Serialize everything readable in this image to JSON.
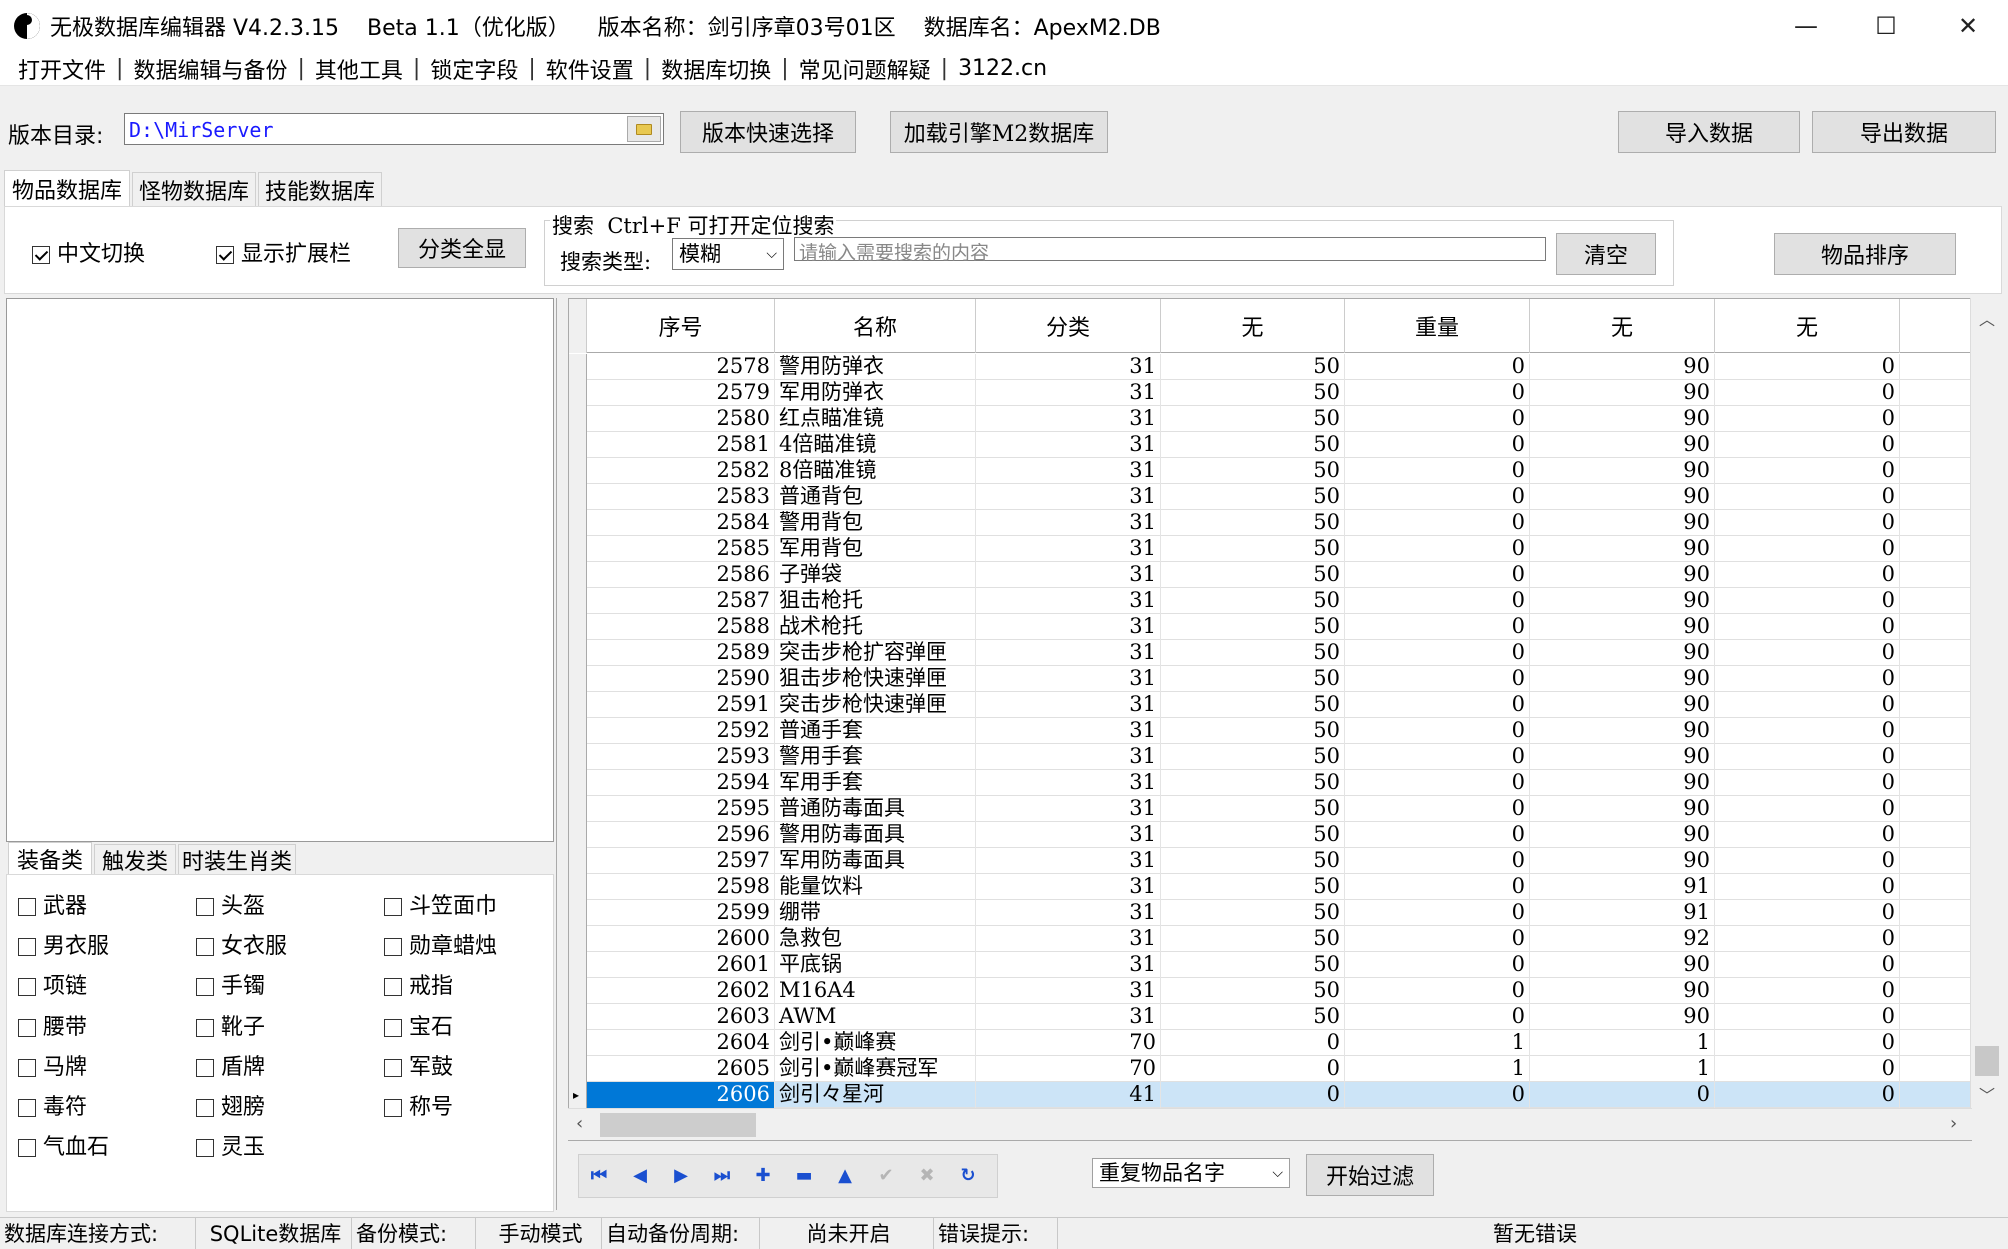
{
  "window": {
    "title": "无极数据库编辑器 V4.2.3.15    Beta 1.1（优化版）    版本名称：剑引序章03号01区    数据库名：ApexM2.DB",
    "minimize": "—",
    "maximize": "☐",
    "close": "✕"
  },
  "menu": {
    "items": [
      "打开文件",
      "数据编辑与备份",
      "其他工具",
      "锁定字段",
      "软件设置",
      "数据库切换",
      "常见问题解疑",
      "3122.cn"
    ],
    "separator": "|"
  },
  "toolbar": {
    "dir_label": "版本目录:",
    "dir_value": "D:\\MirServer",
    "quick_select": "版本快速选择",
    "load_m2": "加载引擎M2数据库",
    "import": "导入数据",
    "export": "导出数据"
  },
  "main_tabs": [
    "物品数据库",
    "怪物数据库",
    "技能数据库"
  ],
  "options": {
    "chinese_toggle": "中文切换",
    "show_ext": "显示扩展栏",
    "show_all_categories": "分类全显",
    "search_title": "搜索  Ctrl+F 可打开定位搜索",
    "search_type_label": "搜索类型:",
    "search_type_value": "模糊",
    "search_placeholder": "请输入需要搜索的内容",
    "clear": "清空",
    "sort": "物品排序"
  },
  "category_tabs": [
    "装备类",
    "触发类",
    "时装生肖类"
  ],
  "categories": [
    [
      "武器",
      "头盔",
      "斗笠面巾"
    ],
    [
      "男衣服",
      "女衣服",
      "勋章蜡烛"
    ],
    [
      "项链",
      "手镯",
      "戒指"
    ],
    [
      "腰带",
      "靴子",
      "宝石"
    ],
    [
      "马牌",
      "盾牌",
      "军鼓"
    ],
    [
      "毒符",
      "翅膀",
      "称号"
    ],
    [
      "气血石",
      "灵玉"
    ]
  ],
  "grid": {
    "columns": [
      "序号",
      "名称",
      "分类",
      "无",
      "重量",
      "无",
      "无"
    ],
    "rows": [
      [
        "2578",
        "警用防弹衣",
        "31",
        "50",
        "0",
        "90",
        "0"
      ],
      [
        "2579",
        "军用防弹衣",
        "31",
        "50",
        "0",
        "90",
        "0"
      ],
      [
        "2580",
        "红点瞄准镜",
        "31",
        "50",
        "0",
        "90",
        "0"
      ],
      [
        "2581",
        "4倍瞄准镜",
        "31",
        "50",
        "0",
        "90",
        "0"
      ],
      [
        "2582",
        "8倍瞄准镜",
        "31",
        "50",
        "0",
        "90",
        "0"
      ],
      [
        "2583",
        "普通背包",
        "31",
        "50",
        "0",
        "90",
        "0"
      ],
      [
        "2584",
        "警用背包",
        "31",
        "50",
        "0",
        "90",
        "0"
      ],
      [
        "2585",
        "军用背包",
        "31",
        "50",
        "0",
        "90",
        "0"
      ],
      [
        "2586",
        "子弹袋",
        "31",
        "50",
        "0",
        "90",
        "0"
      ],
      [
        "2587",
        "狙击枪托",
        "31",
        "50",
        "0",
        "90",
        "0"
      ],
      [
        "2588",
        "战术枪托",
        "31",
        "50",
        "0",
        "90",
        "0"
      ],
      [
        "2589",
        "突击步枪扩容弹匣",
        "31",
        "50",
        "0",
        "90",
        "0"
      ],
      [
        "2590",
        "狙击步枪快速弹匣",
        "31",
        "50",
        "0",
        "90",
        "0"
      ],
      [
        "2591",
        "突击步枪快速弹匣",
        "31",
        "50",
        "0",
        "90",
        "0"
      ],
      [
        "2592",
        "普通手套",
        "31",
        "50",
        "0",
        "90",
        "0"
      ],
      [
        "2593",
        "警用手套",
        "31",
        "50",
        "0",
        "90",
        "0"
      ],
      [
        "2594",
        "军用手套",
        "31",
        "50",
        "0",
        "90",
        "0"
      ],
      [
        "2595",
        "普通防毒面具",
        "31",
        "50",
        "0",
        "90",
        "0"
      ],
      [
        "2596",
        "警用防毒面具",
        "31",
        "50",
        "0",
        "90",
        "0"
      ],
      [
        "2597",
        "军用防毒面具",
        "31",
        "50",
        "0",
        "90",
        "0"
      ],
      [
        "2598",
        "能量饮料",
        "31",
        "50",
        "0",
        "91",
        "0"
      ],
      [
        "2599",
        "绷带",
        "31",
        "50",
        "0",
        "91",
        "0"
      ],
      [
        "2600",
        "急救包",
        "31",
        "50",
        "0",
        "92",
        "0"
      ],
      [
        "2601",
        "平底锅",
        "31",
        "50",
        "0",
        "90",
        "0"
      ],
      [
        "2602",
        "M16A4",
        "31",
        "50",
        "0",
        "90",
        "0"
      ],
      [
        "2603",
        "AWM",
        "31",
        "50",
        "0",
        "90",
        "0"
      ],
      [
        "2604",
        "剑引•巅峰赛",
        "70",
        "0",
        "1",
        "1",
        "0"
      ],
      [
        "2605",
        "剑引•巅峰赛冠军",
        "70",
        "0",
        "1",
        "1",
        "0"
      ],
      [
        "2606",
        "剑引々星河",
        "41",
        "0",
        "0",
        "0",
        "0"
      ]
    ],
    "selected_index": 28
  },
  "filter": {
    "mode_value": "重复物品名字",
    "start": "开始过滤"
  },
  "status": {
    "conn_label": "数据库连接方式:",
    "conn_value": "SQLite数据库",
    "backup_label": "备份模式:",
    "backup_value": "手动模式",
    "auto_label": "自动备份周期:",
    "auto_value": "尚未开启",
    "error_label": "错误提示:",
    "error_value": "暂无错误"
  },
  "icons": {
    "folder": "folder-icon",
    "nav": [
      "first-icon",
      "prior-icon",
      "next-icon",
      "last-icon",
      "insert-icon",
      "delete-icon",
      "edit-icon",
      "post-icon",
      "cancel-icon",
      "refresh-icon"
    ]
  }
}
